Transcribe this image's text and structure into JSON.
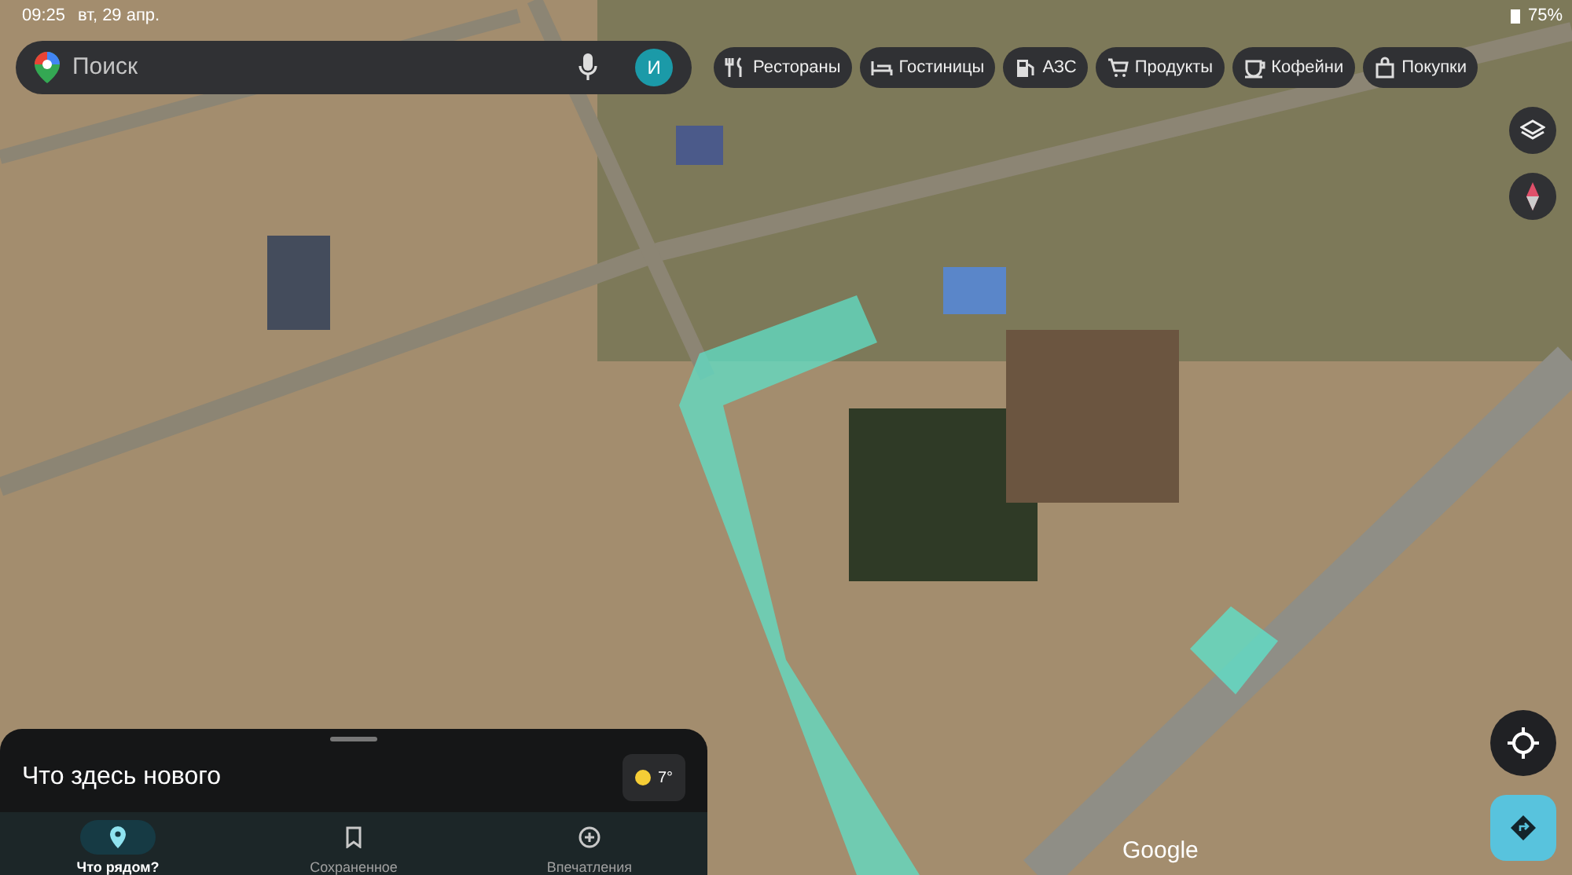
{
  "status_bar": {
    "time": "09:25",
    "date": "вт, 29 апр.",
    "battery": "75%"
  },
  "search": {
    "placeholder": "Поиск",
    "avatar_letter": "И"
  },
  "chips": [
    {
      "label": "Рестораны",
      "kind": "restaurant"
    },
    {
      "label": "Гостиницы",
      "kind": "hotel"
    },
    {
      "label": "АЗС",
      "kind": "fuel"
    },
    {
      "label": "Продукты",
      "kind": "cart"
    },
    {
      "label": "Кофейни",
      "kind": "coffee"
    },
    {
      "label": "Покупки",
      "kind": "bag"
    }
  ],
  "sheet": {
    "title": "Что здесь нового",
    "weather": "7°"
  },
  "nav": [
    {
      "label": "Что рядом?",
      "kind": "pin",
      "selected": true
    },
    {
      "label": "Сохраненное",
      "kind": "bookmark",
      "selected": false
    },
    {
      "label": "Впечатления",
      "kind": "plus",
      "selected": false
    }
  ],
  "attribution": "Google"
}
